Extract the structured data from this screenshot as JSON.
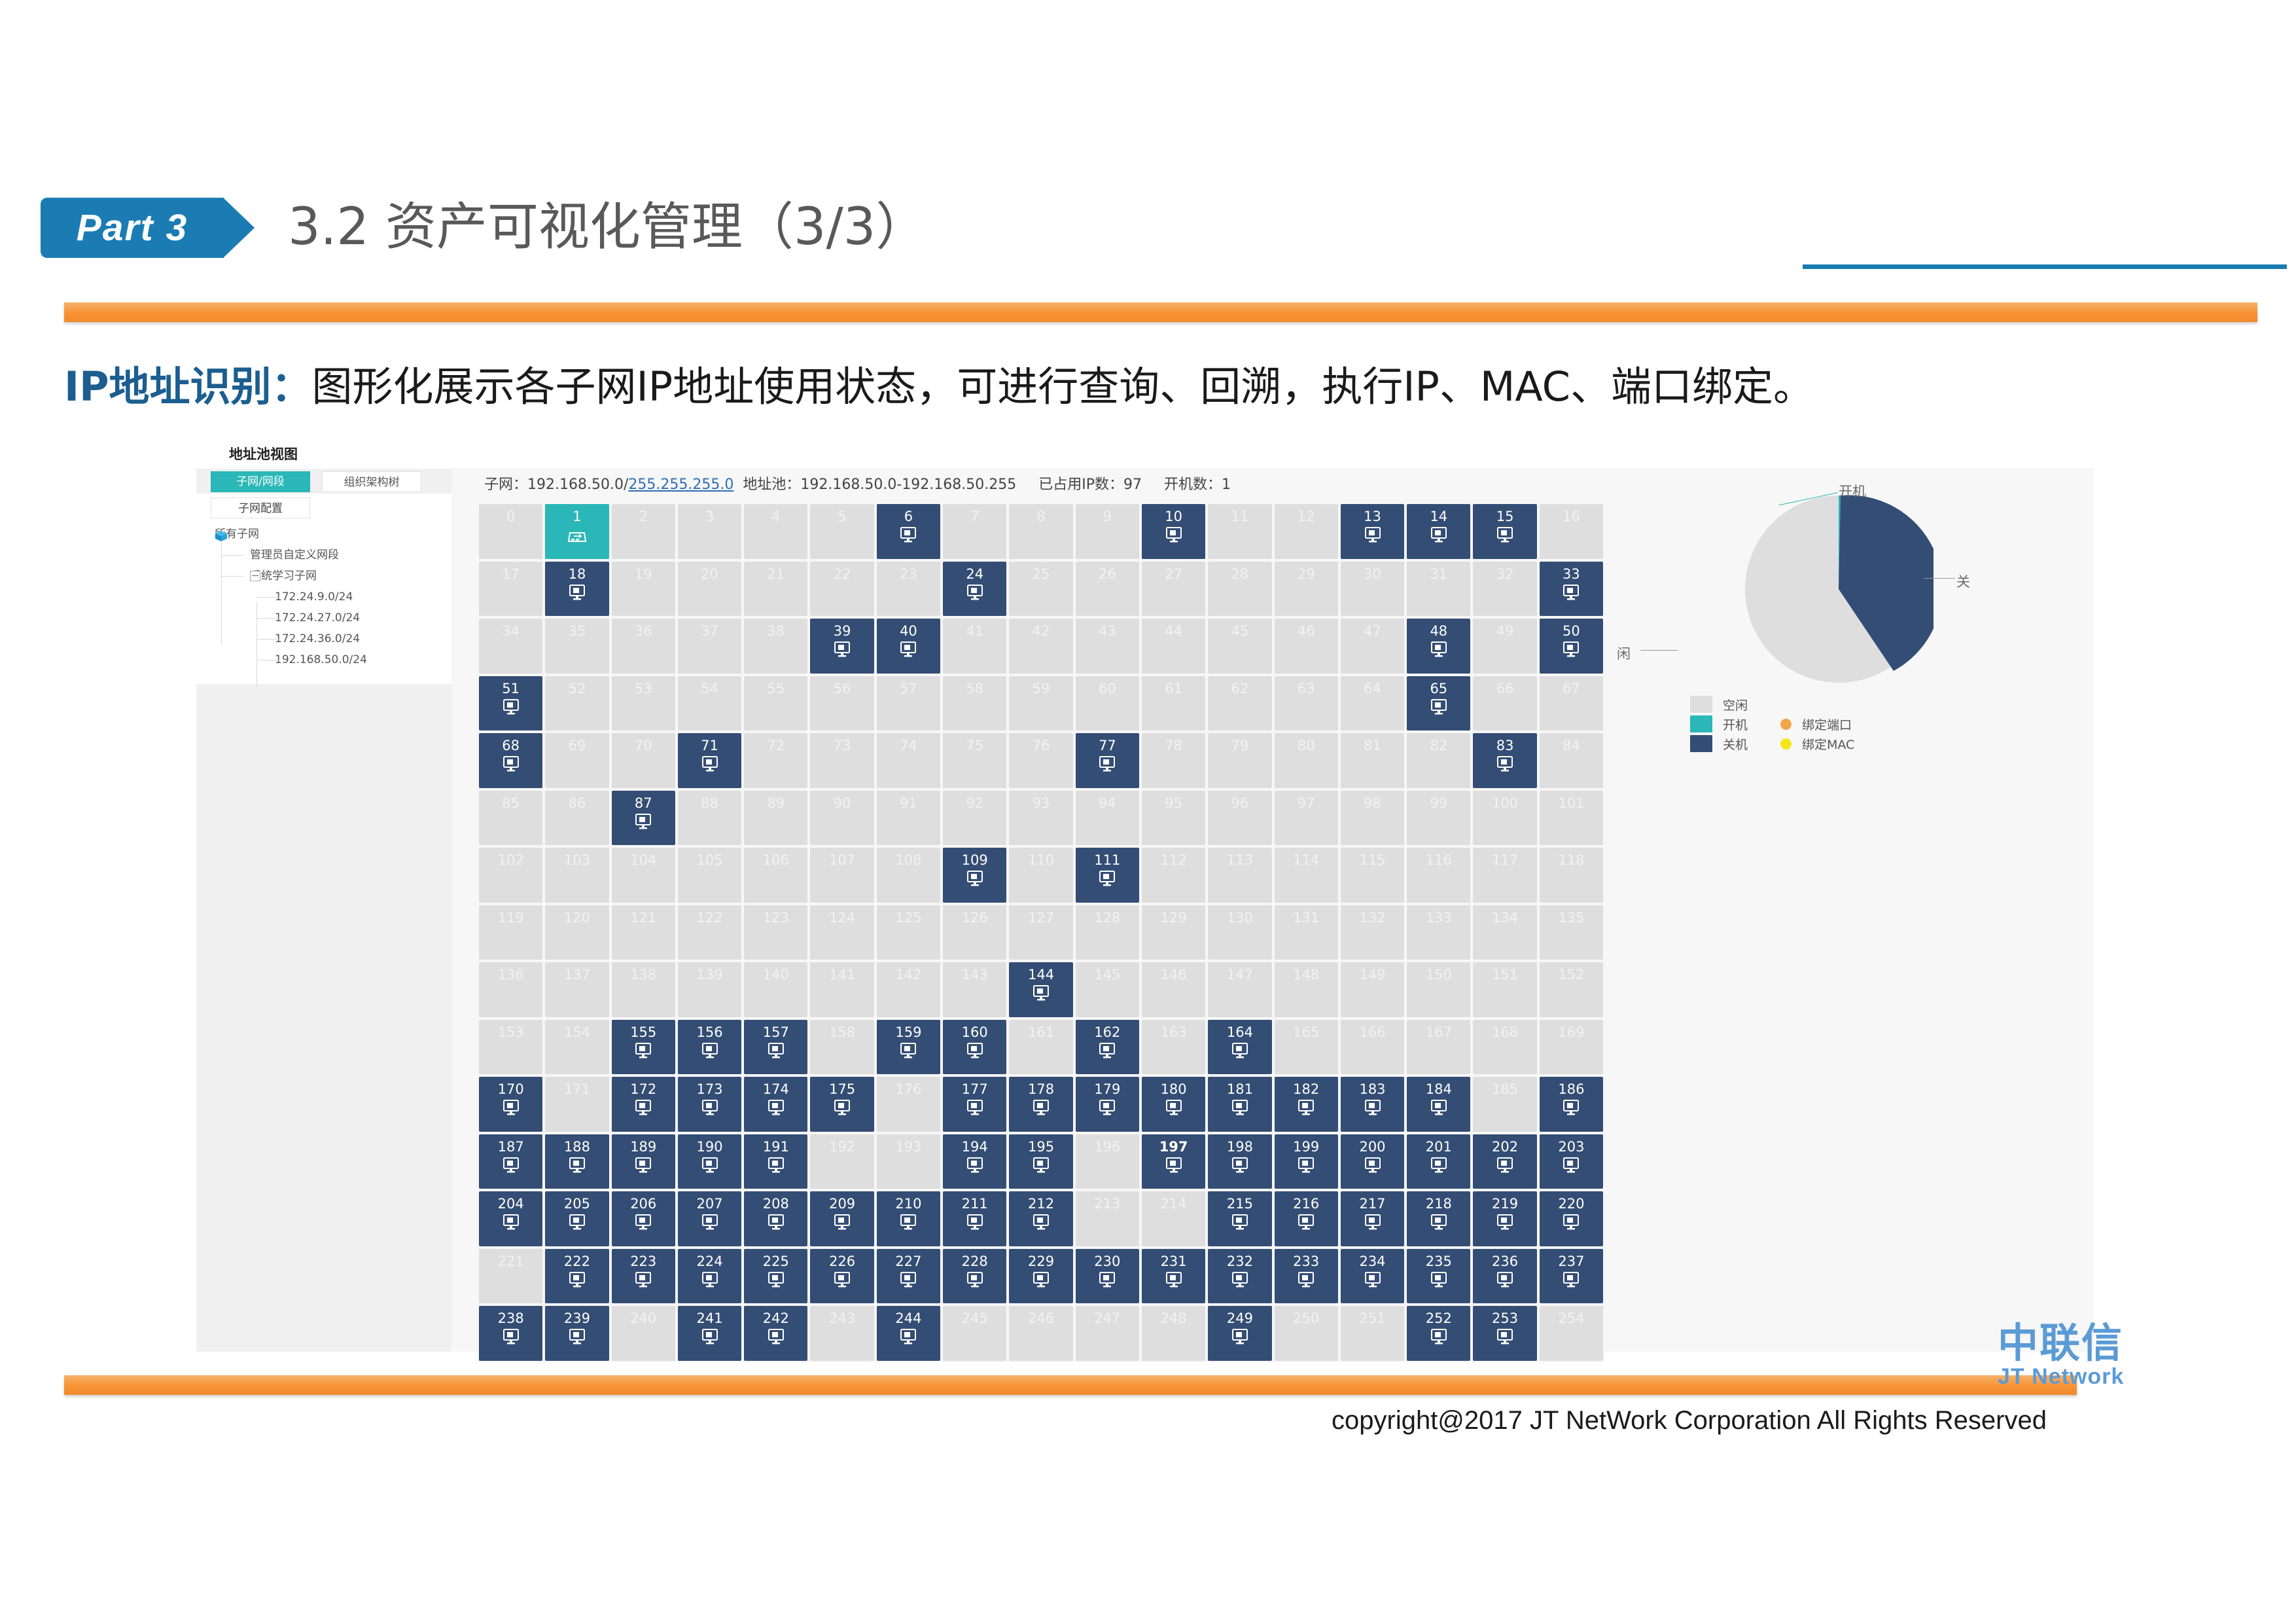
{
  "slide": {
    "part_badge": "Part 3",
    "title": "3.2 资产可视化管理（3/3）",
    "subtitle_label": "IP地址识别：",
    "subtitle_body": "图形化展示各子网IP地址使用状态，可进行查询、回溯，执行IP、MAC、端口绑定。",
    "accent_blue": "#1b7cb3",
    "accent_orange": "#f79235"
  },
  "app": {
    "view_title": "地址池视图",
    "tabs": [
      {
        "label": "子网/网段",
        "active": true
      },
      {
        "label": "组织架构树",
        "active": false
      }
    ],
    "subnet_config_button": "子网配置",
    "tree": {
      "root": "所有子网",
      "children": [
        {
          "label": "管理员自定义网段",
          "level": 1,
          "expandable": false
        },
        {
          "label": "系统学习子网",
          "level": 1,
          "expandable": true,
          "expanded": true
        }
      ],
      "leaves": [
        "172.24.9.0/24",
        "172.24.27.0/24",
        "172.24.36.0/24",
        "192.168.50.0/24"
      ]
    },
    "info": {
      "subnet_label": "子网：",
      "subnet_value": "192.168.50.0/",
      "subnet_mask": "255.255.255.0",
      "pool_label": "地址池：",
      "pool_value": "192.168.50.0-192.168.50.255",
      "used_label": "已占用IP数：",
      "used_value": "97",
      "online_label": "开机数：",
      "online_value": "1"
    },
    "grid": {
      "columns": 17,
      "first": 0,
      "last": 254,
      "on": [
        1
      ],
      "selected": [
        197
      ],
      "off": [
        6,
        10,
        13,
        14,
        15,
        18,
        24,
        33,
        39,
        40,
        48,
        50,
        51,
        65,
        68,
        71,
        77,
        83,
        87,
        109,
        111,
        144,
        155,
        156,
        157,
        159,
        160,
        162,
        164,
        170,
        172,
        173,
        174,
        175,
        177,
        178,
        179,
        180,
        181,
        182,
        183,
        184,
        186,
        187,
        188,
        189,
        190,
        191,
        194,
        195,
        197,
        198,
        199,
        200,
        201,
        202,
        203,
        204,
        205,
        206,
        207,
        208,
        209,
        210,
        211,
        212,
        215,
        216,
        217,
        218,
        219,
        220,
        222,
        223,
        224,
        225,
        226,
        227,
        228,
        229,
        230,
        231,
        232,
        233,
        234,
        235,
        236,
        237,
        238,
        239,
        241,
        242,
        244,
        249,
        252,
        253
      ],
      "icon_on": "server-icon",
      "icon_off": "monitor-icon"
    },
    "colors": {
      "idle": "#dedede",
      "on": "#2bb7b7",
      "off": "#344d74",
      "bind_port": "#f2a64b",
      "bind_mac": "#f5e61c"
    }
  },
  "chart_data": {
    "type": "pie",
    "title": "",
    "labels": [
      "闲",
      "开机",
      "关"
    ],
    "legend_entries": [
      {
        "label": "空闲",
        "color": "#dedede",
        "kind": "swatch"
      },
      {
        "label": "开机",
        "color": "#2bb7b7",
        "kind": "swatch"
      },
      {
        "label": "关机",
        "color": "#344d74",
        "kind": "swatch"
      },
      {
        "label": "绑定端口",
        "color": "#f2a64b",
        "kind": "dot"
      },
      {
        "label": "绑定MAC",
        "color": "#f5e61c",
        "kind": "dot"
      }
    ],
    "categories": [
      "空闲",
      "开机",
      "关机"
    ],
    "values": [
      158,
      1,
      96
    ],
    "percentages": [
      62.0,
      0.4,
      37.6
    ],
    "legend_position": "bottom-left",
    "grid": false
  },
  "footer": {
    "logo_cn": "中联信",
    "logo_en": "JT Network",
    "copyright": "copyright@2017  JT NetWork Corporation All Rights Reserved"
  }
}
